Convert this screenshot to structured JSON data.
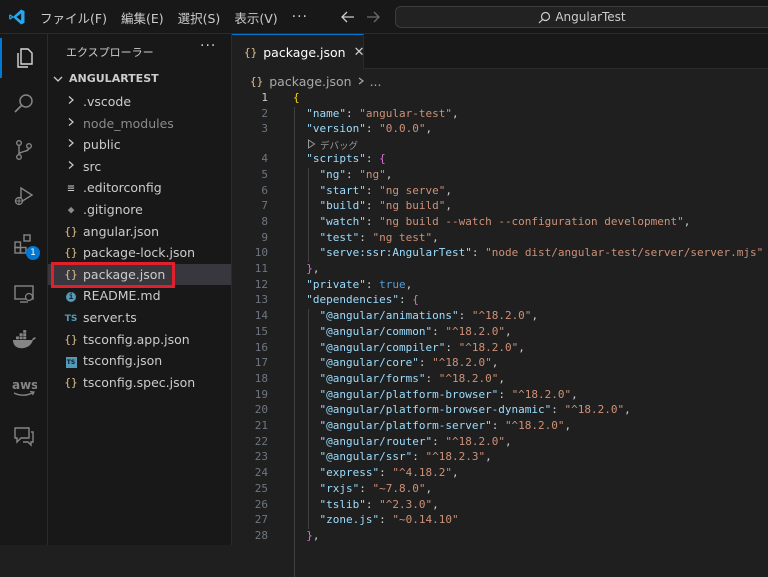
{
  "titlebar": {
    "menu": [
      "ファイル(F)",
      "編集(E)",
      "選択(S)",
      "表示(V)"
    ],
    "more": "···",
    "search_text": "AngularTest"
  },
  "activity_bar": {
    "icons": [
      "explorer-icon",
      "search-icon",
      "source-control-icon",
      "run-debug-icon",
      "extensions-icon",
      "remote-explorer-icon",
      "docker-icon",
      "aws-icon",
      "chat-icon"
    ],
    "extensions_badge": "1"
  },
  "sidebar": {
    "title": "エクスプローラー",
    "more": "···",
    "root": "ANGULARTEST",
    "items": [
      {
        "label": ".vscode",
        "icon": "chevron-right",
        "dim": false
      },
      {
        "label": "node_modules",
        "icon": "chevron-right",
        "dim": true
      },
      {
        "label": "public",
        "icon": "chevron-right",
        "dim": false
      },
      {
        "label": "src",
        "icon": "chevron-right",
        "dim": false
      },
      {
        "label": ".editorconfig",
        "icon": "lines",
        "dim": false
      },
      {
        "label": ".gitignore",
        "icon": "git",
        "dim": false
      },
      {
        "label": "angular.json",
        "icon": "json",
        "dim": false
      },
      {
        "label": "package-lock.json",
        "icon": "json",
        "dim": false
      },
      {
        "label": "package.json",
        "icon": "json",
        "dim": false,
        "selected": true
      },
      {
        "label": "README.md",
        "icon": "info",
        "dim": false
      },
      {
        "label": "server.ts",
        "icon": "ts",
        "dim": false
      },
      {
        "label": "tsconfig.app.json",
        "icon": "json",
        "dim": false
      },
      {
        "label": "tsconfig.json",
        "icon": "tsconfig",
        "dim": false
      },
      {
        "label": "tsconfig.spec.json",
        "icon": "json",
        "dim": false
      }
    ]
  },
  "editor": {
    "tab_label": "package.json",
    "breadcrumb_file": "package.json",
    "breadcrumb_rest": "...",
    "codelens": "デバッグ",
    "lines": [
      {
        "n": "1",
        "t": "{"
      },
      {
        "n": "2",
        "t": "  \"name\": \"angular-test\","
      },
      {
        "n": "3",
        "t": "  \"version\": \"0.0.0\","
      },
      {
        "n": "4",
        "t": "  \"scripts\": {"
      },
      {
        "n": "5",
        "t": "    \"ng\": \"ng\","
      },
      {
        "n": "6",
        "t": "    \"start\": \"ng serve\","
      },
      {
        "n": "7",
        "t": "    \"build\": \"ng build\","
      },
      {
        "n": "8",
        "t": "    \"watch\": \"ng build --watch --configuration development\","
      },
      {
        "n": "9",
        "t": "    \"test\": \"ng test\","
      },
      {
        "n": "10",
        "t": "    \"serve:ssr:AngularTest\": \"node dist/angular-test/server/server.mjs\""
      },
      {
        "n": "11",
        "t": "  },"
      },
      {
        "n": "12",
        "t": "  \"private\": true,"
      },
      {
        "n": "13",
        "t": "  \"dependencies\": {"
      },
      {
        "n": "14",
        "t": "    \"@angular/animations\": \"^18.2.0\","
      },
      {
        "n": "15",
        "t": "    \"@angular/common\": \"^18.2.0\","
      },
      {
        "n": "16",
        "t": "    \"@angular/compiler\": \"^18.2.0\","
      },
      {
        "n": "17",
        "t": "    \"@angular/core\": \"^18.2.0\","
      },
      {
        "n": "18",
        "t": "    \"@angular/forms\": \"^18.2.0\","
      },
      {
        "n": "19",
        "t": "    \"@angular/platform-browser\": \"^18.2.0\","
      },
      {
        "n": "20",
        "t": "    \"@angular/platform-browser-dynamic\": \"^18.2.0\","
      },
      {
        "n": "21",
        "t": "    \"@angular/platform-server\": \"^18.2.0\","
      },
      {
        "n": "22",
        "t": "    \"@angular/router\": \"^18.2.0\","
      },
      {
        "n": "23",
        "t": "    \"@angular/ssr\": \"^18.2.3\","
      },
      {
        "n": "24",
        "t": "    \"express\": \"^4.18.2\","
      },
      {
        "n": "25",
        "t": "    \"rxjs\": \"~7.8.0\","
      },
      {
        "n": "26",
        "t": "    \"tslib\": \"^2.3.0\","
      },
      {
        "n": "27",
        "t": "    \"zone.js\": \"~0.14.10\""
      },
      {
        "n": "28",
        "t": "  },"
      }
    ]
  },
  "colors": {
    "accent": "#0078d4",
    "highlight_box": "#e0202a",
    "json_key": "#9cdcfe",
    "json_string": "#ce9178",
    "json_keyword": "#569cd6"
  }
}
